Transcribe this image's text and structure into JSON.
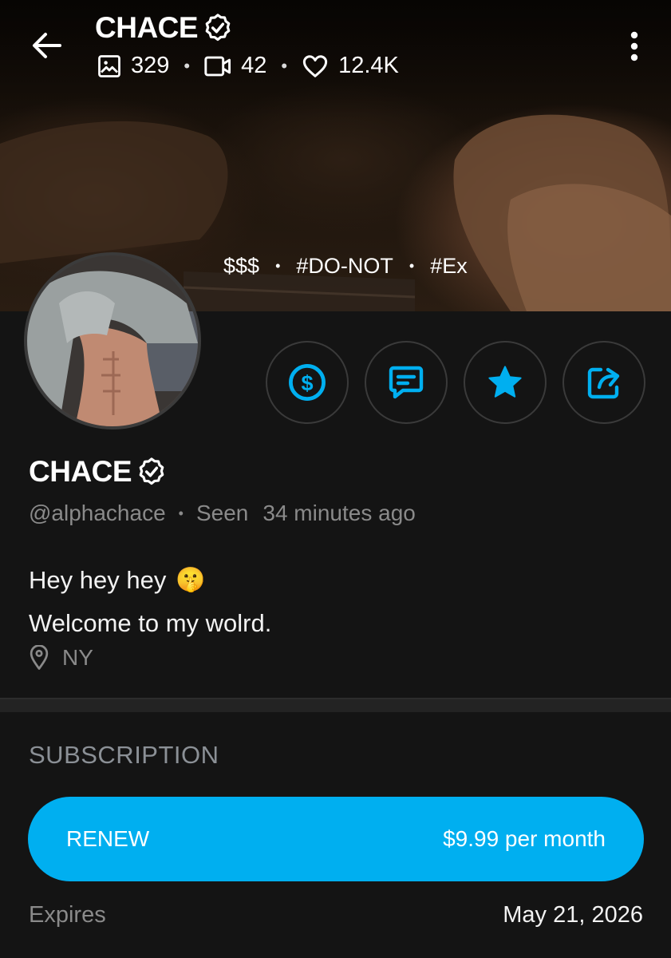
{
  "header": {
    "name": "CHACE",
    "stats": {
      "photos": "329",
      "videos": "42",
      "likes": "12.4K"
    }
  },
  "cover": {
    "tags": [
      "$$$",
      "#DO-NOT",
      "#Ex"
    ]
  },
  "actions": [
    {
      "icon": "dollar-icon"
    },
    {
      "icon": "message-icon"
    },
    {
      "icon": "star-icon"
    },
    {
      "icon": "share-icon"
    }
  ],
  "profile": {
    "name": "CHACE",
    "handle": "@alphachace",
    "seen_label": "Seen",
    "seen_time": "34 minutes ago",
    "bio_line1": "Hey hey hey",
    "bio_emoji": "🤫",
    "bio_line2": "Welcome to my wolrd.",
    "location": "NY"
  },
  "subscription": {
    "title": "SUBSCRIPTION",
    "renew_label": "RENEW",
    "price": "$9.99 per month",
    "expires_label": "Expires",
    "expires_date": "May 21, 2026"
  },
  "colors": {
    "accent": "#00aff0",
    "background": "#141414",
    "muted": "#8a8a8a"
  }
}
